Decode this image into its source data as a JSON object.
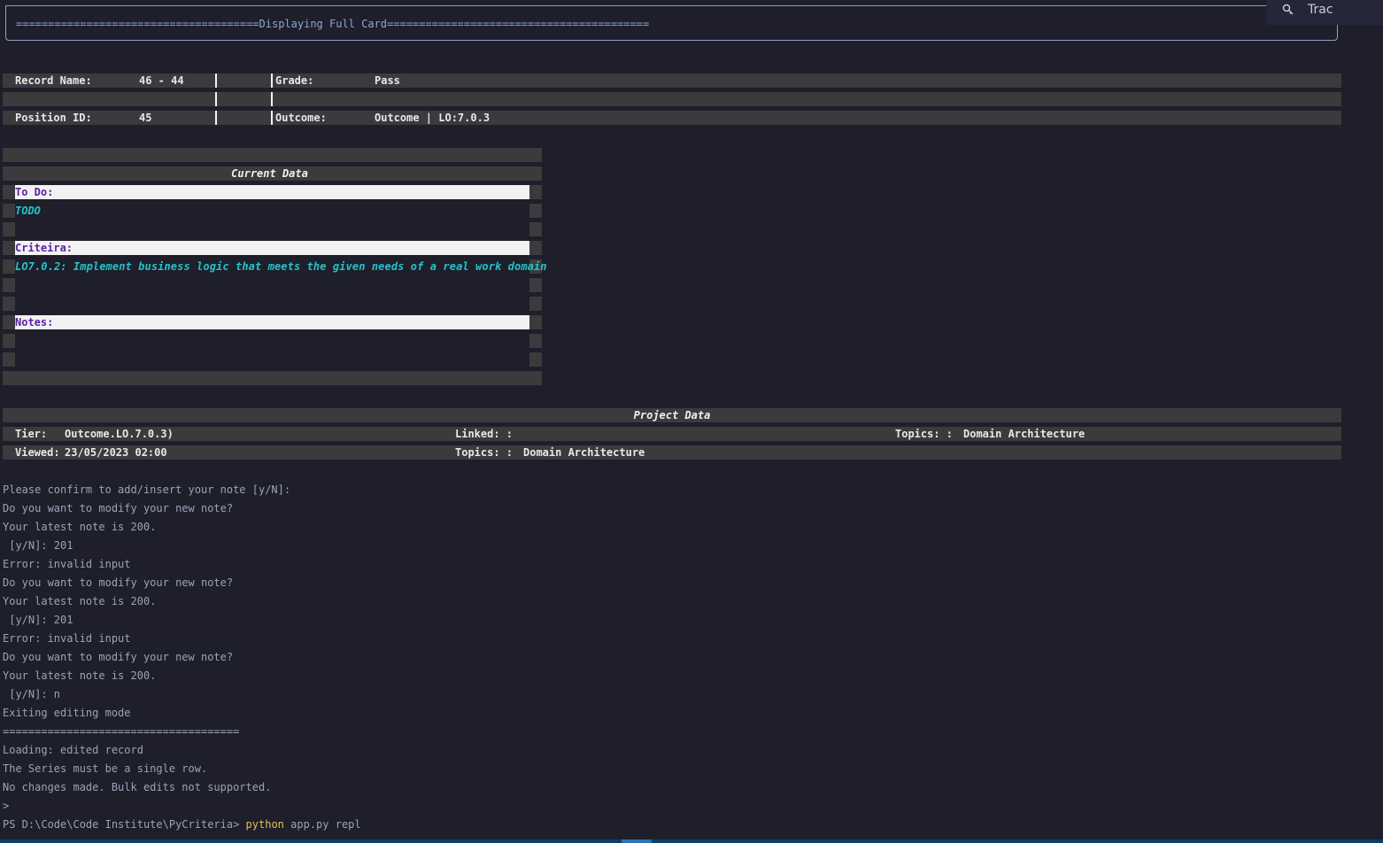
{
  "header": {
    "title_line": "======================================Displaying Full Card========================================="
  },
  "search": {
    "icon": "search-icon",
    "text": "Trac"
  },
  "record": {
    "name_label": "Record Name:",
    "name_value": "46 - 44",
    "grade_label": "Grade:",
    "grade_value": "Pass",
    "position_label": "Position ID:",
    "position_value": "45",
    "outcome_label": "Outcome:",
    "outcome_value": "Outcome | LO:7.0.3"
  },
  "current_data": {
    "title": "Current Data",
    "todo_label": "To Do:",
    "todo_value": "TODO",
    "criteria_label": "Criteira:",
    "criteria_value": "LO7.0.2: Implement business logic that meets the given needs of a real work domain",
    "notes_label": "Notes:"
  },
  "project_data": {
    "title": "Project Data",
    "tier_label": "Tier:",
    "tier_value": "Outcome.LO.7.0.3)",
    "linked_label": "Linked: :",
    "topics_label": "Topics: :",
    "topics_value": "Domain Architecture",
    "viewed_label": "Viewed:",
    "viewed_value": "23/05/2023 02:00",
    "topics2_label": "Topics: :",
    "topics2_value": "Domain Architecture"
  },
  "console": {
    "lines": [
      "Please confirm to add/insert your note [y/N]:",
      "Do you want to modify your new note?",
      "Your latest note is 200.",
      " [y/N]: 201",
      "Error: invalid input",
      "Do you want to modify your new note?",
      "Your latest note is 200.",
      " [y/N]: 201",
      "Error: invalid input",
      "Do you want to modify your new note?",
      "Your latest note is 200.",
      " [y/N]: n",
      "Exiting editing mode",
      "=====================================",
      "Loading: edited record",
      "The Series must be a single row.",
      "No changes made. Bulk edits not supported.",
      ">"
    ],
    "prompt_path": "PS D:\\Code\\Code Institute\\PyCriteria>",
    "prompt_cmd": "python",
    "prompt_args": "app.py repl"
  }
}
